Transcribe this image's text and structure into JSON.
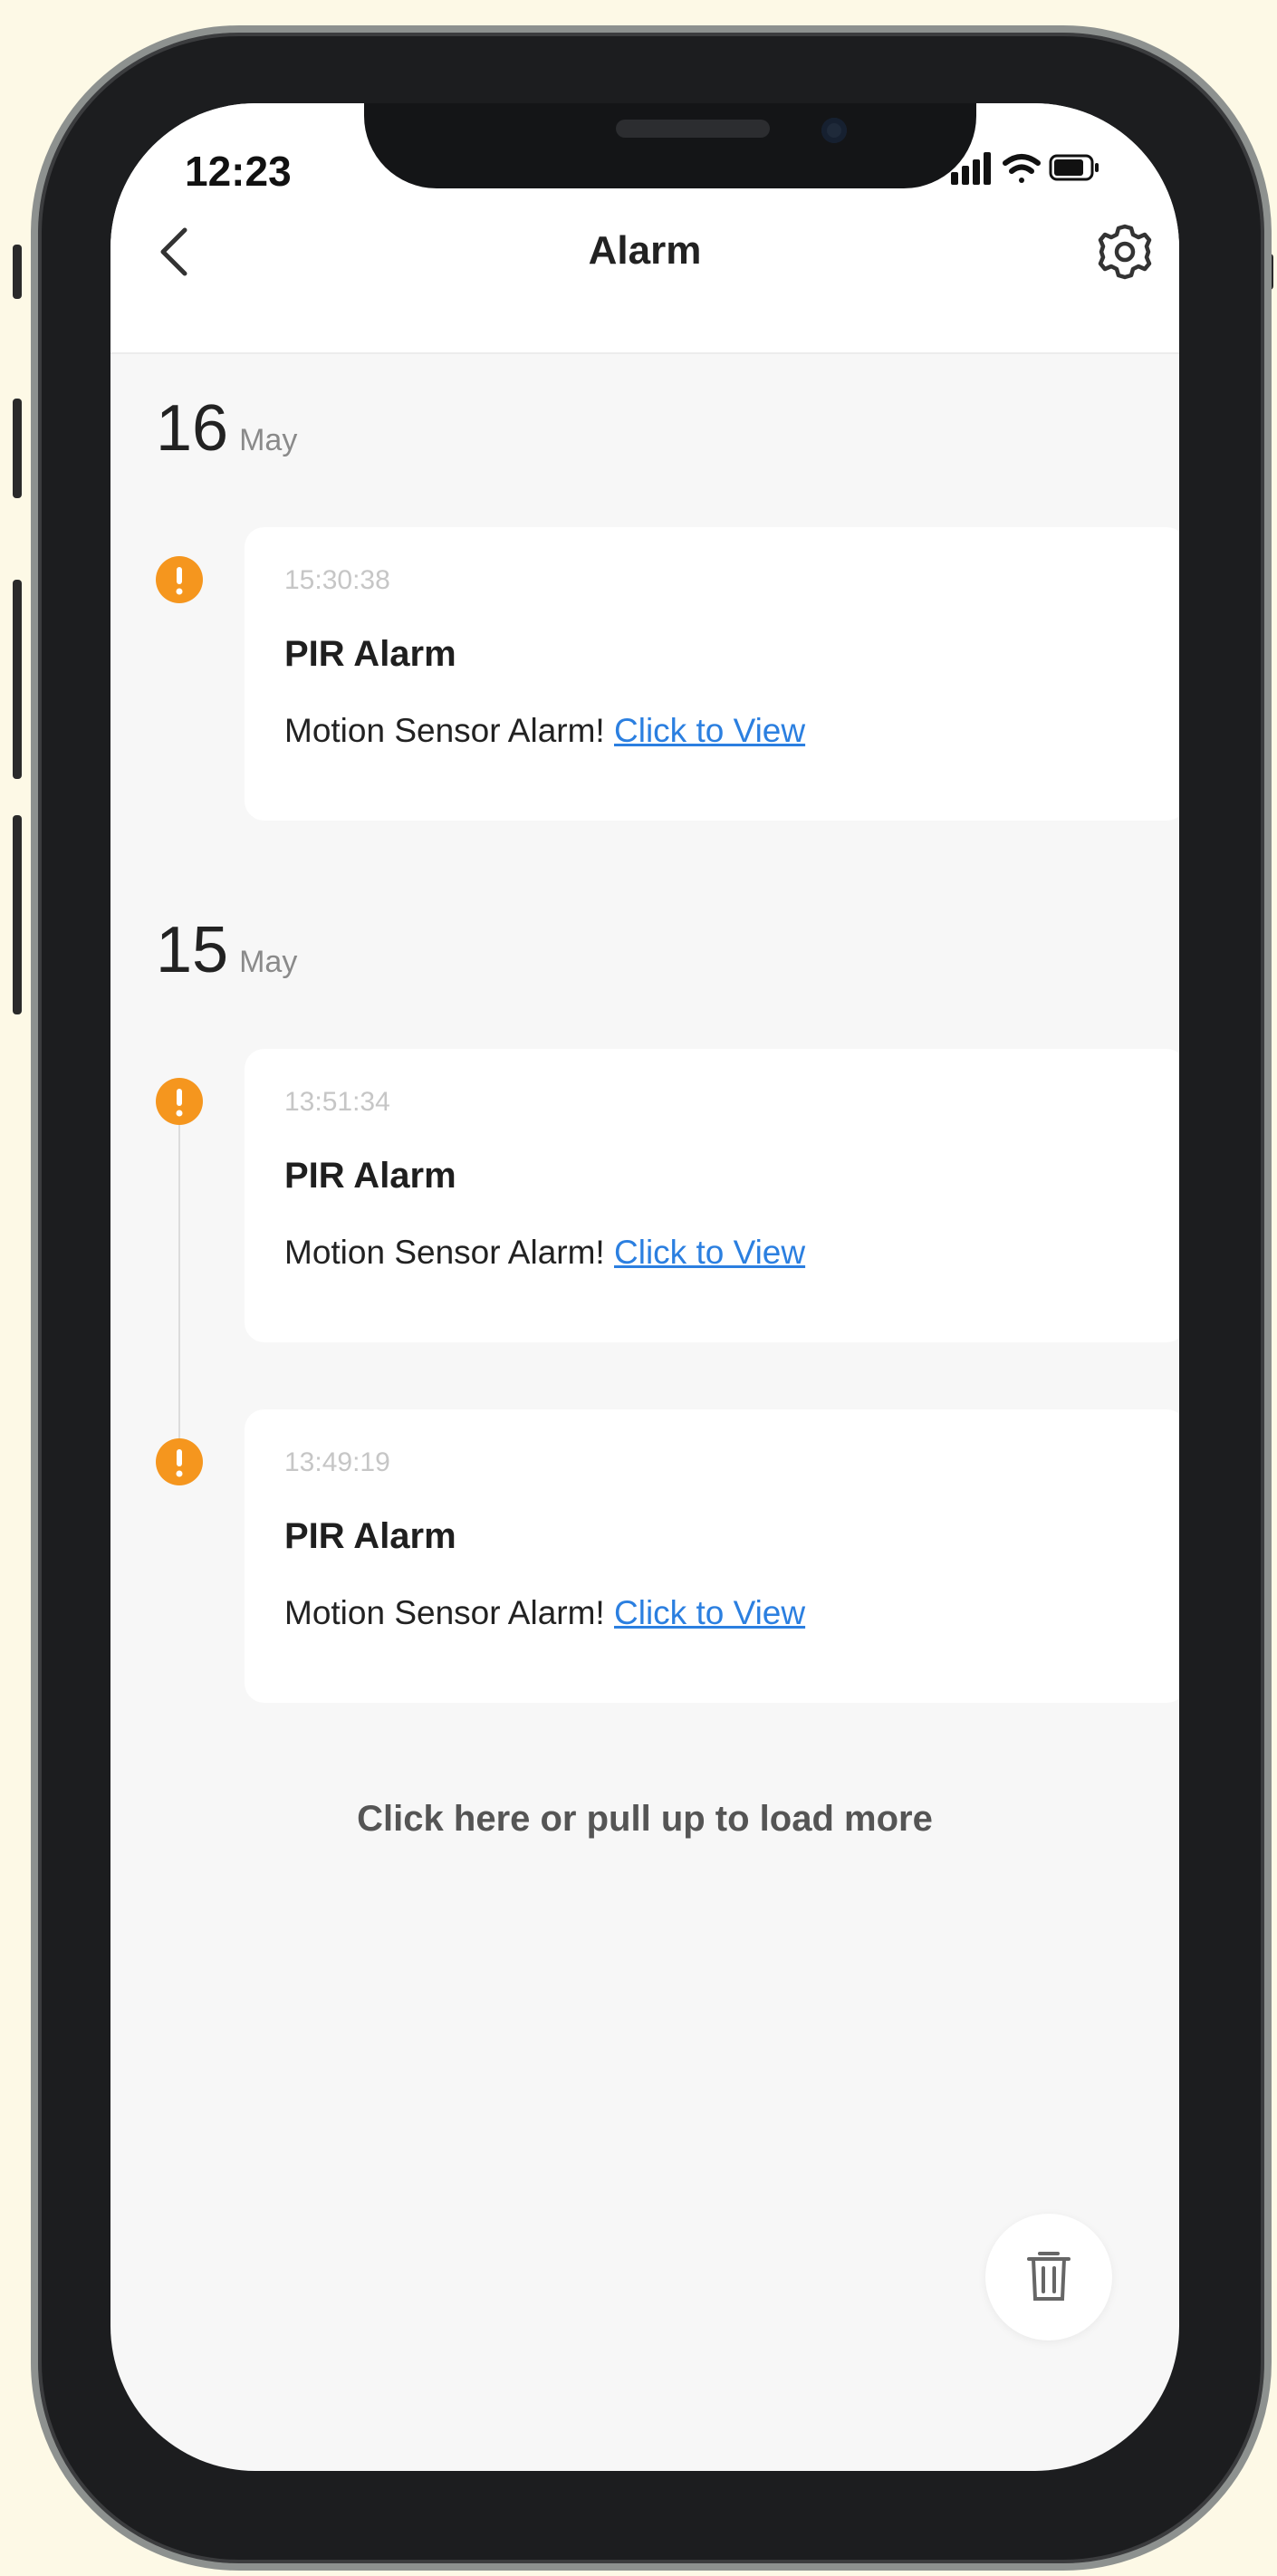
{
  "status_bar": {
    "time": "12:23"
  },
  "header": {
    "title": "Alarm"
  },
  "groups": [
    {
      "day": "16",
      "month": "May",
      "alarms": [
        {
          "time": "15:30:38",
          "title": "PIR Alarm",
          "message": "Motion Sensor Alarm!",
          "link": "Click to View"
        }
      ]
    },
    {
      "day": "15",
      "month": "May",
      "alarms": [
        {
          "time": "13:51:34",
          "title": "PIR Alarm",
          "message": "Motion Sensor Alarm!",
          "link": "Click to View"
        },
        {
          "time": "13:49:19",
          "title": "PIR Alarm",
          "message": "Motion Sensor Alarm!",
          "link": "Click to View"
        }
      ]
    }
  ],
  "footer": {
    "load_more": "Click here or pull up to load more"
  },
  "colors": {
    "accent": "#2b7fe0",
    "alert": "#f5961e",
    "background": "#f7f7f7"
  },
  "icons": {
    "back": "chevron-left-icon",
    "settings": "gear-icon",
    "alert": "exclamation-circle-icon",
    "delete": "trash-icon",
    "signal": "signal-icon",
    "wifi": "wifi-icon",
    "battery": "battery-icon"
  }
}
